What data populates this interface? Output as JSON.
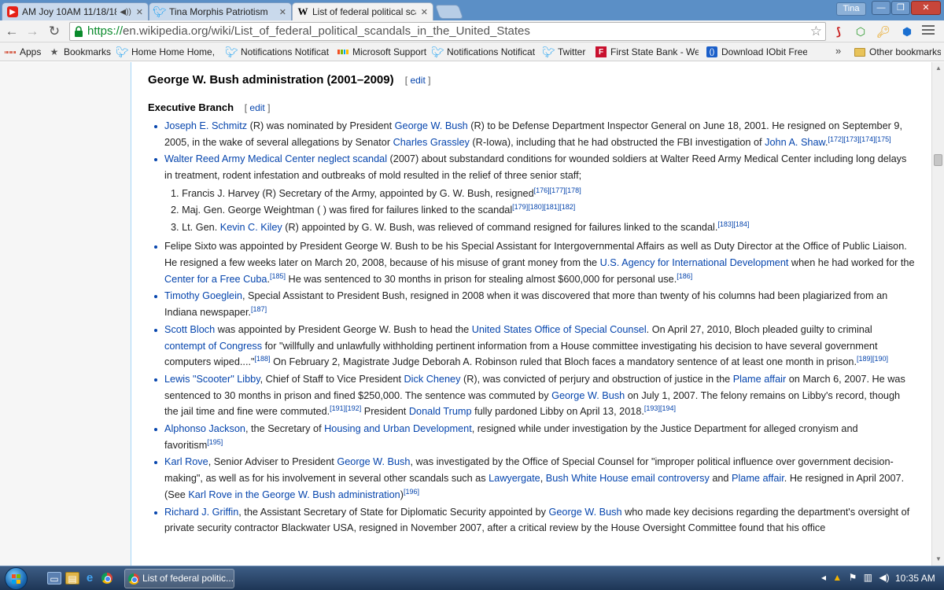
{
  "browser": {
    "tabs": [
      {
        "title": "AM Joy 10AM 11/18/18",
        "icon": "youtube-icon",
        "audio": true
      },
      {
        "title": "Tina Morphis Patriotism",
        "icon": "twitter-icon"
      },
      {
        "title": "List of federal political sca",
        "icon": "wikipedia-icon",
        "active": true
      }
    ],
    "profile": "Tina",
    "url_scheme": "https://",
    "url_rest": "en.wikipedia.org/wiki/List_of_federal_political_scandals_in_the_United_States",
    "bookmarks": [
      {
        "label": "Apps",
        "icon": "apps-icon"
      },
      {
        "label": "Bookmarks",
        "icon": "star-icon"
      },
      {
        "label": "Home Home Home,",
        "icon": "twitter-icon"
      },
      {
        "label": "Notifications Notificat",
        "icon": "twitter-icon"
      },
      {
        "label": "Microsoft Support",
        "icon": "microsoft-icon"
      },
      {
        "label": "Notifications Notificat",
        "icon": "twitter-icon"
      },
      {
        "label": "Twitter",
        "icon": "twitter-icon"
      },
      {
        "label": "First State Bank - Welc",
        "icon": "bank-icon"
      },
      {
        "label": "Download IObit Free",
        "icon": "iobit-icon"
      }
    ],
    "bookmarks_more": "»",
    "other_bookmarks": "Other bookmarks"
  },
  "article": {
    "section_title": "George W. Bush administration (2001–2009)",
    "subsection_title": "Executive Branch",
    "edit_label": "edit",
    "items": [
      {
        "html": "<a>Joseph E. Schmitz</a> (R) was nominated by President <a>George W. Bush</a> (R) to be Defense Department Inspector General on June 18, 2001. He resigned on September 9, 2005, in the wake of several allegations by Senator <a>Charles Grassley</a> (R-Iowa), including that he had obstructed the FBI investigation of <a>John A. Shaw</a>.<sup>[172][173][174][175]</sup>"
      },
      {
        "html": "<a>Walter Reed Army Medical Center neglect scandal</a> (2007) about substandard conditions for wounded soldiers at Walter Reed Army Medical Center including long delays in treatment, rodent infestation and outbreaks of mold resulted in the relief of three senior staff;",
        "sub": [
          "1. Francis J. Harvey (R) Secretary of the Army, appointed by G. W. Bush, resigned<sup>[176][177][178]</sup>",
          "2. Maj. Gen. George Weightman ( ) was fired for failures linked to the scandal<sup>[179][180][181][182]</sup>",
          "3. Lt. Gen. <a>Kevin C. Kiley</a> (R) appointed by G. W. Bush, was relieved of command resigned for failures linked to the scandal.<sup>[183][184]</sup>"
        ]
      },
      {
        "html": "Felipe Sixto was appointed by President George W. Bush to be his Special Assistant for Intergovernmental Affairs as well as Duty Director at the Office of Public Liaison. He resigned a few weeks later on March 20, 2008, because of his misuse of grant money from the <a>U.S. Agency for International Development</a> when he had worked for the <a>Center for a Free Cuba</a>.<sup>[185]</sup> He was sentenced to 30 months in prison for stealing almost $600,000 for personal use.<sup>[186]</sup>"
      },
      {
        "html": "<a>Timothy Goeglein</a>, Special Assistant to President Bush, resigned in 2008 when it was discovered that more than twenty of his columns had been plagiarized from an Indiana newspaper.<sup>[187]</sup>"
      },
      {
        "html": "<a>Scott Bloch</a> was appointed by President George W. Bush to head the <a>United States Office of Special Counsel</a>. On April 27, 2010, Bloch pleaded guilty to criminal <a>contempt of Congress</a> for \"willfully and unlawfully withholding pertinent information from a House committee investigating his decision to have several government computers wiped....\"<sup>[188]</sup> On February 2, Magistrate Judge Deborah A. Robinson ruled that Bloch faces a mandatory sentence of at least one month in prison.<sup>[189][190]</sup>"
      },
      {
        "html": "<a>Lewis \"Scooter\" Libby</a>, Chief of Staff to Vice President <a>Dick Cheney</a> (R), was convicted of perjury and obstruction of justice in the <a>Plame affair</a> on March 6, 2007. He was sentenced to 30 months in prison and fined $250,000. The sentence was commuted by <a>George W. Bush</a> on July 1, 2007. The felony remains on Libby's record, though the jail time and fine were commuted.<sup>[191][192]</sup> President <a>Donald Trump</a> fully pardoned Libby on April 13, 2018.<sup>[193][194]</sup>"
      },
      {
        "html": "<a>Alphonso Jackson</a>, the Secretary of <a>Housing and Urban Development</a>, resigned while under investigation by the Justice Department for alleged cronyism and favoritism<sup>[195]</sup>"
      },
      {
        "html": "<a>Karl Rove</a>, Senior Adviser to President <a>George W. Bush</a>, was investigated by the Office of Special Counsel for \"improper political influence over government decision-making\", as well as for his involvement in several other scandals such as <a>Lawyergate</a>, <a>Bush White House email controversy</a> and <a>Plame affair</a>. He resigned in April 2007. (See <a>Karl Rove in the George W. Bush administration</a>)<sup>[196]</sup>"
      },
      {
        "html": "<a>Richard J. Griffin</a>, the Assistant Secretary of State for Diplomatic Security appointed by <a>George W. Bush</a> who made key decisions regarding the department's oversight of private security contractor Blackwater USA, resigned in November 2007, after a critical review by the House Oversight Committee found that his office"
      }
    ]
  },
  "taskbar": {
    "active_window": "List of federal politic...",
    "clock": "10:35 AM"
  },
  "colors": {
    "link": "#0645ad",
    "tabstrip": "#5b8fc6",
    "taskbar": "#1e3656"
  }
}
